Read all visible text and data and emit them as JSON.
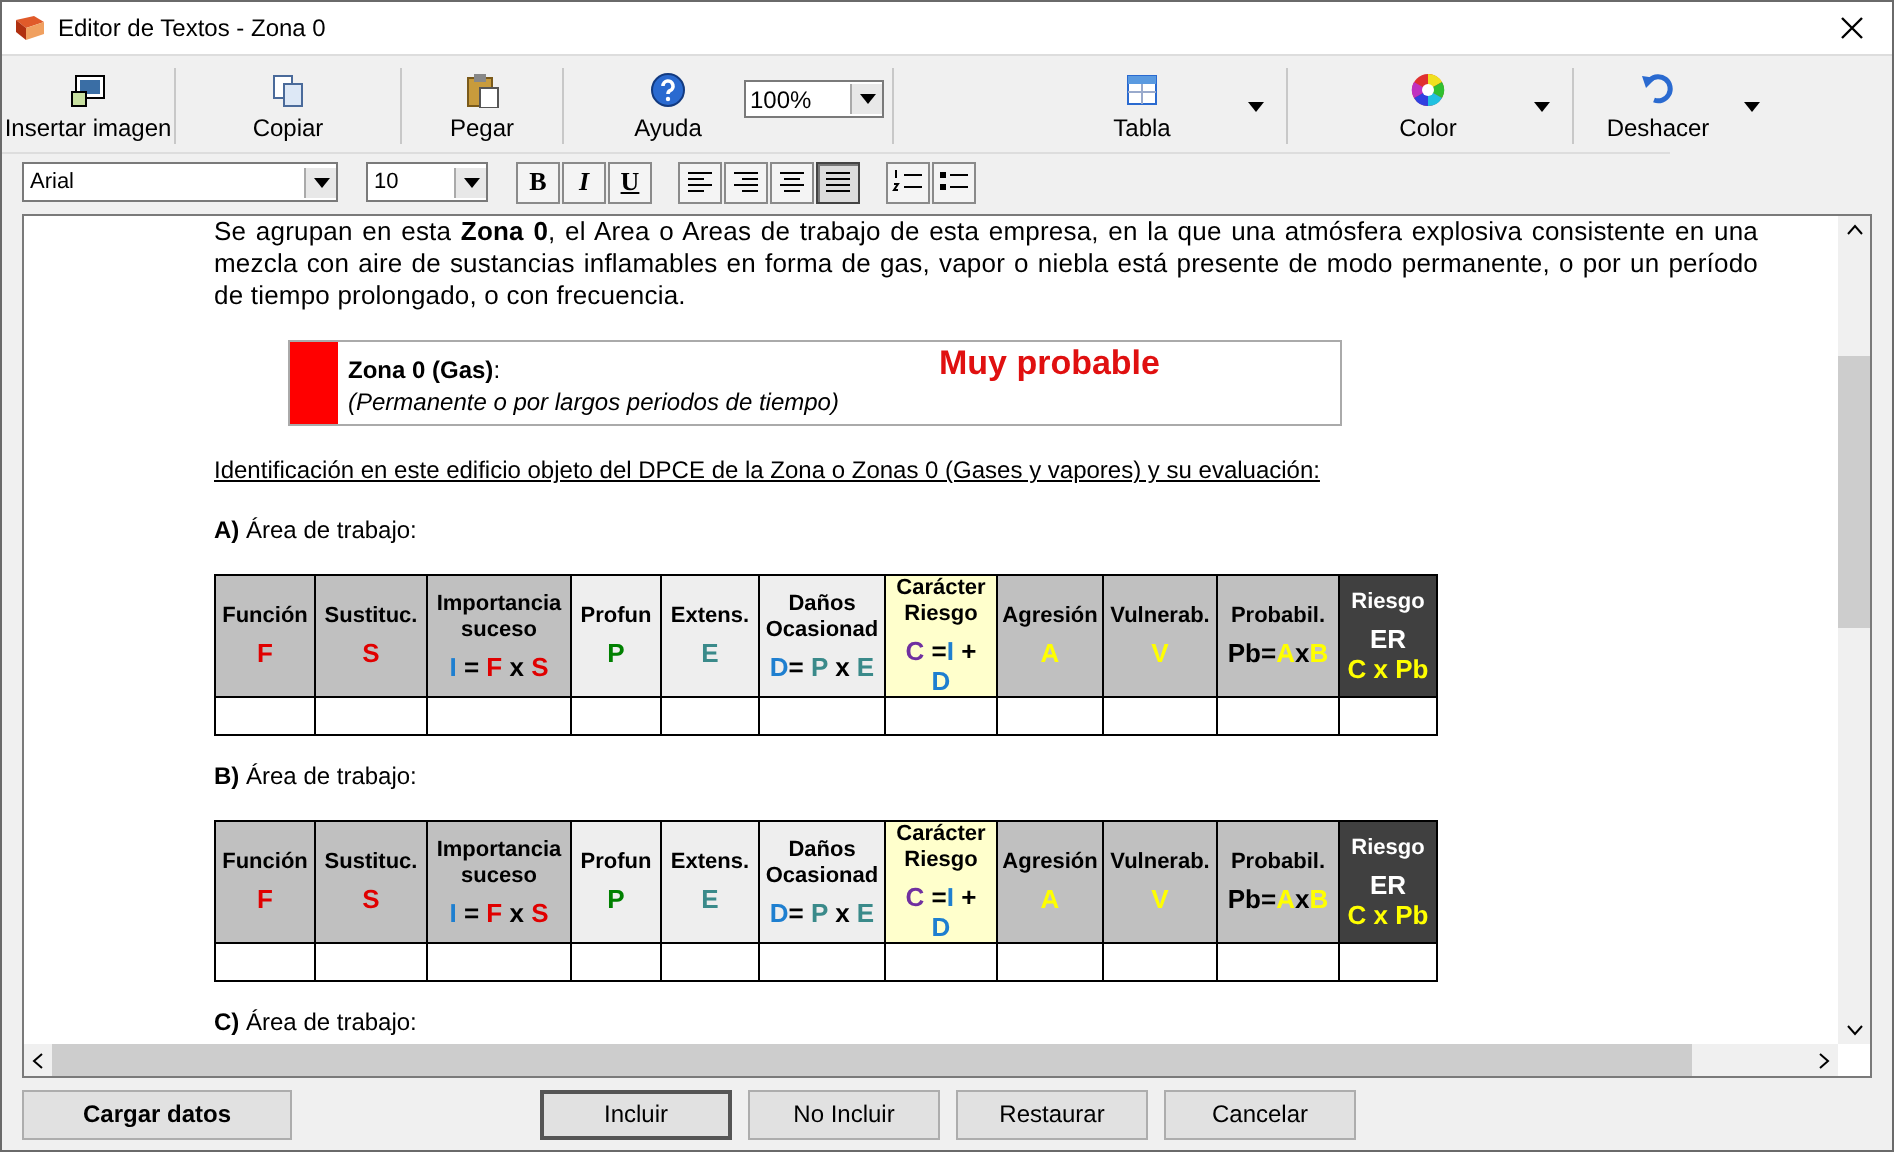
{
  "window": {
    "title": "Editor de Textos - Zona 0"
  },
  "toolbar": {
    "items": [
      {
        "kind": "image",
        "label": "Insertar imagen",
        "has_menu": false
      },
      {
        "kind": "copy",
        "label": "Copiar",
        "has_menu": false
      },
      {
        "kind": "paste",
        "label": "Pegar",
        "has_menu": false
      },
      {
        "kind": "help",
        "label": "Ayuda",
        "has_menu": false
      },
      {
        "kind": "zoom",
        "value": "100%"
      },
      {
        "kind": "table",
        "label": "Tabla",
        "has_menu": true
      },
      {
        "kind": "color",
        "label": "Color",
        "has_menu": true
      },
      {
        "kind": "undo",
        "label": "Deshacer",
        "has_menu": true
      }
    ]
  },
  "format_bar": {
    "font": "Arial",
    "size": "10",
    "buttons": [
      {
        "kind": "bold",
        "label": "B",
        "selected": false
      },
      {
        "kind": "italic",
        "label": "I",
        "selected": false
      },
      {
        "kind": "underline",
        "label": "U",
        "selected": false
      },
      {
        "kind": "align-left",
        "selected": false
      },
      {
        "kind": "align-right",
        "selected": false
      },
      {
        "kind": "align-center",
        "selected": false
      },
      {
        "kind": "justify",
        "selected": true
      },
      {
        "kind": "numbered-list",
        "selected": false
      },
      {
        "kind": "bullet-list",
        "selected": false
      }
    ]
  },
  "document": [
    {
      "kind": "paragraph",
      "text": "Se agrupan en esta **Zona 0**, el Area o Areas de trabajo de esta empresa, en la que una atmósfera explosiva consistente en una mezcla con aire de sustancias inflamables en forma de gas, vapor o niebla está presente de modo permanente, o por un período de tiempo prolongado, o con frecuencia."
    },
    {
      "kind": "zone_box",
      "color": "#ff0000",
      "title": "**Zona 0 (Gas)**:",
      "subtitle": "(Permanente o por largos periodos de tiempo)",
      "rating": "Muy probable"
    },
    {
      "kind": "underlined",
      "text": "Identificación en este edificio objeto del DPCE de la Zona o Zonas 0 (Gases y vapores) y su evaluación:"
    },
    {
      "kind": "area_label",
      "text": "**A)** Área de trabajo:"
    },
    {
      "kind": "table",
      "columns": [
        {
          "name": "Función",
          "color": "#c0c0c0",
          "formula": [
            [
              {
                "text": "F",
                "color": "#e00000"
              }
            ]
          ]
        },
        {
          "name": "Sustituc.",
          "color": "#c0c0c0",
          "formula": [
            [
              {
                "text": "S",
                "color": "#e00000"
              }
            ]
          ]
        },
        {
          "name": "Importancia suceso",
          "color": "#c0c0c0",
          "formula": [
            [
              {
                "text": "I",
                "color": "#1e7fd0"
              },
              {
                "text": " = ",
                "color": "#000000"
              },
              {
                "text": "F",
                "color": "#e00000"
              },
              {
                "text": " x ",
                "color": "#000000"
              },
              {
                "text": "S",
                "color": "#e00000"
              }
            ]
          ]
        },
        {
          "name": "Profun",
          "color": "#eeeeee",
          "formula": [
            [
              {
                "text": "P",
                "color": "#008000"
              }
            ]
          ]
        },
        {
          "name": "Extens.",
          "color": "#eeeeee",
          "formula": [
            [
              {
                "text": "E",
                "color": "#3a8a8a"
              }
            ]
          ]
        },
        {
          "name": "Daños Ocasionad",
          "color": "#eeeeee",
          "formula": [
            [
              {
                "text": "D",
                "color": "#1e7fd0"
              },
              {
                "text": "= ",
                "color": "#000000"
              },
              {
                "text": "P",
                "color": "#3a8a8a"
              },
              {
                "text": " x ",
                "color": "#000000"
              },
              {
                "text": "E",
                "color": "#3a8a8a"
              }
            ]
          ]
        },
        {
          "name": "Carácter Riesgo",
          "color": "#ffffcc",
          "formula": [
            [
              {
                "text": "C",
                "color": "#7030a0"
              },
              {
                "text": " =",
                "color": "#000000"
              },
              {
                "text": "I",
                "color": "#1e7fd0"
              },
              {
                "text": " +",
                "color": "#000000"
              }
            ],
            [
              {
                "text": "D",
                "color": "#1e7fd0"
              }
            ]
          ]
        },
        {
          "name": "Agresión",
          "color": "#c0c0c0",
          "formula": [
            [
              {
                "text": "A",
                "color": "#ffff00"
              }
            ]
          ]
        },
        {
          "name": "Vulnerab.",
          "color": "#c0c0c0",
          "formula": [
            [
              {
                "text": "V",
                "color": "#ffff00"
              }
            ]
          ]
        },
        {
          "name": "Probabil.",
          "color": "#c0c0c0",
          "formula": [
            [
              {
                "text": "Pb=",
                "color": "#000000"
              },
              {
                "text": "A",
                "color": "#ffff00"
              },
              {
                "text": "x",
                "color": "#000000"
              },
              {
                "text": "B",
                "color": "#ffff00"
              }
            ]
          ]
        },
        {
          "name": "Riesgo",
          "color": "#404040",
          "formula": [
            [
              {
                "text": "ER",
                "color": "#ffffff"
              }
            ],
            [
              {
                "text": "C x Pb",
                "color": "#ffff00"
              }
            ]
          ]
        }
      ]
    },
    {
      "kind": "area_label",
      "text": "**B)** Área de trabajo:"
    },
    {
      "kind": "table",
      "columns": [
        {
          "name": "Función",
          "color": "#c0c0c0",
          "formula": [
            [
              {
                "text": "F",
                "color": "#e00000"
              }
            ]
          ]
        },
        {
          "name": "Sustituc.",
          "color": "#c0c0c0",
          "formula": [
            [
              {
                "text": "S",
                "color": "#e00000"
              }
            ]
          ]
        },
        {
          "name": "Importancia suceso",
          "color": "#c0c0c0",
          "formula": [
            [
              {
                "text": "I",
                "color": "#1e7fd0"
              },
              {
                "text": " = ",
                "color": "#000000"
              },
              {
                "text": "F",
                "color": "#e00000"
              },
              {
                "text": " x ",
                "color": "#000000"
              },
              {
                "text": "S",
                "color": "#e00000"
              }
            ]
          ]
        },
        {
          "name": "Profun",
          "color": "#eeeeee",
          "formula": [
            [
              {
                "text": "P",
                "color": "#008000"
              }
            ]
          ]
        },
        {
          "name": "Extens.",
          "color": "#eeeeee",
          "formula": [
            [
              {
                "text": "E",
                "color": "#3a8a8a"
              }
            ]
          ]
        },
        {
          "name": "Daños Ocasionad",
          "color": "#eeeeee",
          "formula": [
            [
              {
                "text": "D",
                "color": "#1e7fd0"
              },
              {
                "text": "= ",
                "color": "#000000"
              },
              {
                "text": "P",
                "color": "#3a8a8a"
              },
              {
                "text": " x ",
                "color": "#000000"
              },
              {
                "text": "E",
                "color": "#3a8a8a"
              }
            ]
          ]
        },
        {
          "name": "Carácter Riesgo",
          "color": "#ffffcc",
          "formula": [
            [
              {
                "text": "C",
                "color": "#7030a0"
              },
              {
                "text": " =",
                "color": "#000000"
              },
              {
                "text": "I",
                "color": "#1e7fd0"
              },
              {
                "text": " +",
                "color": "#000000"
              }
            ],
            [
              {
                "text": "D",
                "color": "#1e7fd0"
              }
            ]
          ]
        },
        {
          "name": "Agresión",
          "color": "#c0c0c0",
          "formula": [
            [
              {
                "text": "A",
                "color": "#ffff00"
              }
            ]
          ]
        },
        {
          "name": "Vulnerab.",
          "color": "#c0c0c0",
          "formula": [
            [
              {
                "text": "V",
                "color": "#ffff00"
              }
            ]
          ]
        },
        {
          "name": "Probabil.",
          "color": "#c0c0c0",
          "formula": [
            [
              {
                "text": "Pb=",
                "color": "#000000"
              },
              {
                "text": "A",
                "color": "#ffff00"
              },
              {
                "text": "x",
                "color": "#000000"
              },
              {
                "text": "B",
                "color": "#ffff00"
              }
            ]
          ]
        },
        {
          "name": "Riesgo",
          "color": "#404040",
          "formula": [
            [
              {
                "text": "ER",
                "color": "#ffffff"
              }
            ],
            [
              {
                "text": "C x Pb",
                "color": "#ffff00"
              }
            ]
          ]
        }
      ]
    },
    {
      "kind": "area_label",
      "text": "**C)** Área de trabajo:"
    }
  ],
  "buttons": [
    {
      "label": "Cargar datos",
      "kind": "strong",
      "default": false
    },
    {
      "label": "Incluir",
      "kind": "plain",
      "default": true
    },
    {
      "label": "No Incluir",
      "kind": "plain",
      "default": false
    },
    {
      "label": "Restaurar",
      "kind": "plain",
      "default": false
    },
    {
      "label": "Cancelar",
      "kind": "plain",
      "default": false
    }
  ]
}
